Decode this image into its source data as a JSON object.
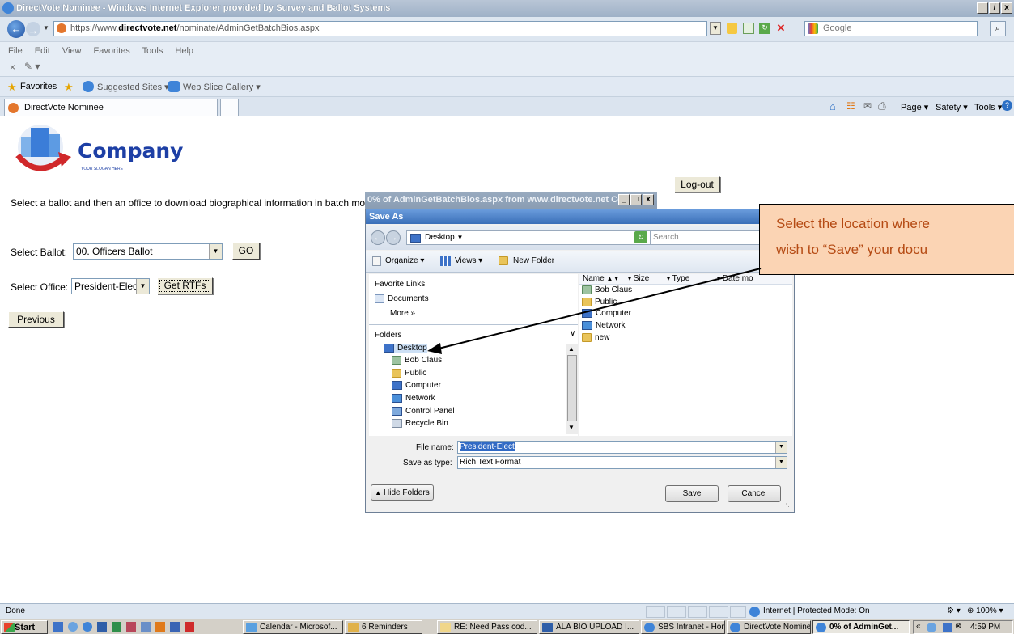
{
  "window": {
    "title": "DirectVote Nominee - Windows Internet Explorer provided by Survey and Ballot Systems",
    "controls": [
      "_",
      "̸",
      "x"
    ]
  },
  "address_bar": {
    "url_scheme": "https://www.",
    "url_domain": "directvote.net",
    "url_path": "/nominate/AdminGetBatchBios.aspx",
    "search_placeholder": "Google"
  },
  "menu": {
    "items": [
      "File",
      "Edit",
      "View",
      "Favorites",
      "Tools",
      "Help"
    ]
  },
  "favorites_bar": {
    "favorites_label": "Favorites",
    "suggested_sites": "Suggested Sites ▾",
    "web_slice": "Web Slice Gallery ▾"
  },
  "tabs": {
    "active_tab": "DirectVote Nominee",
    "cmd_page": "Page ▾",
    "cmd_safety": "Safety ▾",
    "cmd_tools": "Tools ▾"
  },
  "page": {
    "logo_text": "Company",
    "logo_slogan": "YOUR SLOGAN HERE",
    "logout": "Log-out",
    "instructions": "Select a ballot and then an office to download biographical information in batch mode (a",
    "ballot_label": "Select Ballot:",
    "ballot_value": "00. Officers Ballot",
    "go_button": "GO",
    "office_label": "Select Office:",
    "office_value": "President-Elect",
    "get_rtfs_button": "Get RTFs",
    "previous_button": "Previous"
  },
  "download_window": {
    "title": "0% of AdminGetBatchBios.aspx from www.directvote.net Co..."
  },
  "save_dialog": {
    "title": "Save As",
    "location": "Desktop",
    "search_placeholder": "Search",
    "organize": "Organize",
    "views": "Views",
    "new_folder": "New Folder",
    "favorite_links_header": "Favorite Links",
    "favorite_links": [
      "Documents",
      "More »"
    ],
    "folders_header": "Folders",
    "folder_tree": [
      "Desktop",
      "Bob Claus",
      "Public",
      "Computer",
      "Network",
      "Control Panel",
      "Recycle Bin"
    ],
    "columns": [
      "Name",
      "Size",
      "Type",
      "Date mo"
    ],
    "files": [
      "Bob Claus",
      "Public",
      "Computer",
      "Network",
      "new"
    ],
    "file_name_label": "File name:",
    "file_name_value": "President-Elect",
    "save_type_label": "Save as type:",
    "save_type_value": "Rich Text Format",
    "hide_folders": "Hide Folders",
    "save_button": "Save",
    "cancel_button": "Cancel"
  },
  "callout": {
    "line1": "Select the location where",
    "line2": "wish to “Save” your docu"
  },
  "status_bar": {
    "status": "Done",
    "zone": "Internet | Protected Mode: On",
    "zoom": "100%"
  },
  "taskbar": {
    "start": "Start",
    "items": [
      "Calendar - Microsof...",
      "6 Reminders",
      "RE: Need Pass cod...",
      "ALA BIO UPLOAD I...",
      "SBS Intranet - Hom...",
      "DirectVote Nominee...",
      "0% of AdminGet..."
    ],
    "clock": "4:59 PM"
  },
  "colors": {
    "callout_fill": "#fbd4b4",
    "callout_text": "#b54a13",
    "logo_blue": "#1d3fa5",
    "logo_red": "#d0282b"
  }
}
